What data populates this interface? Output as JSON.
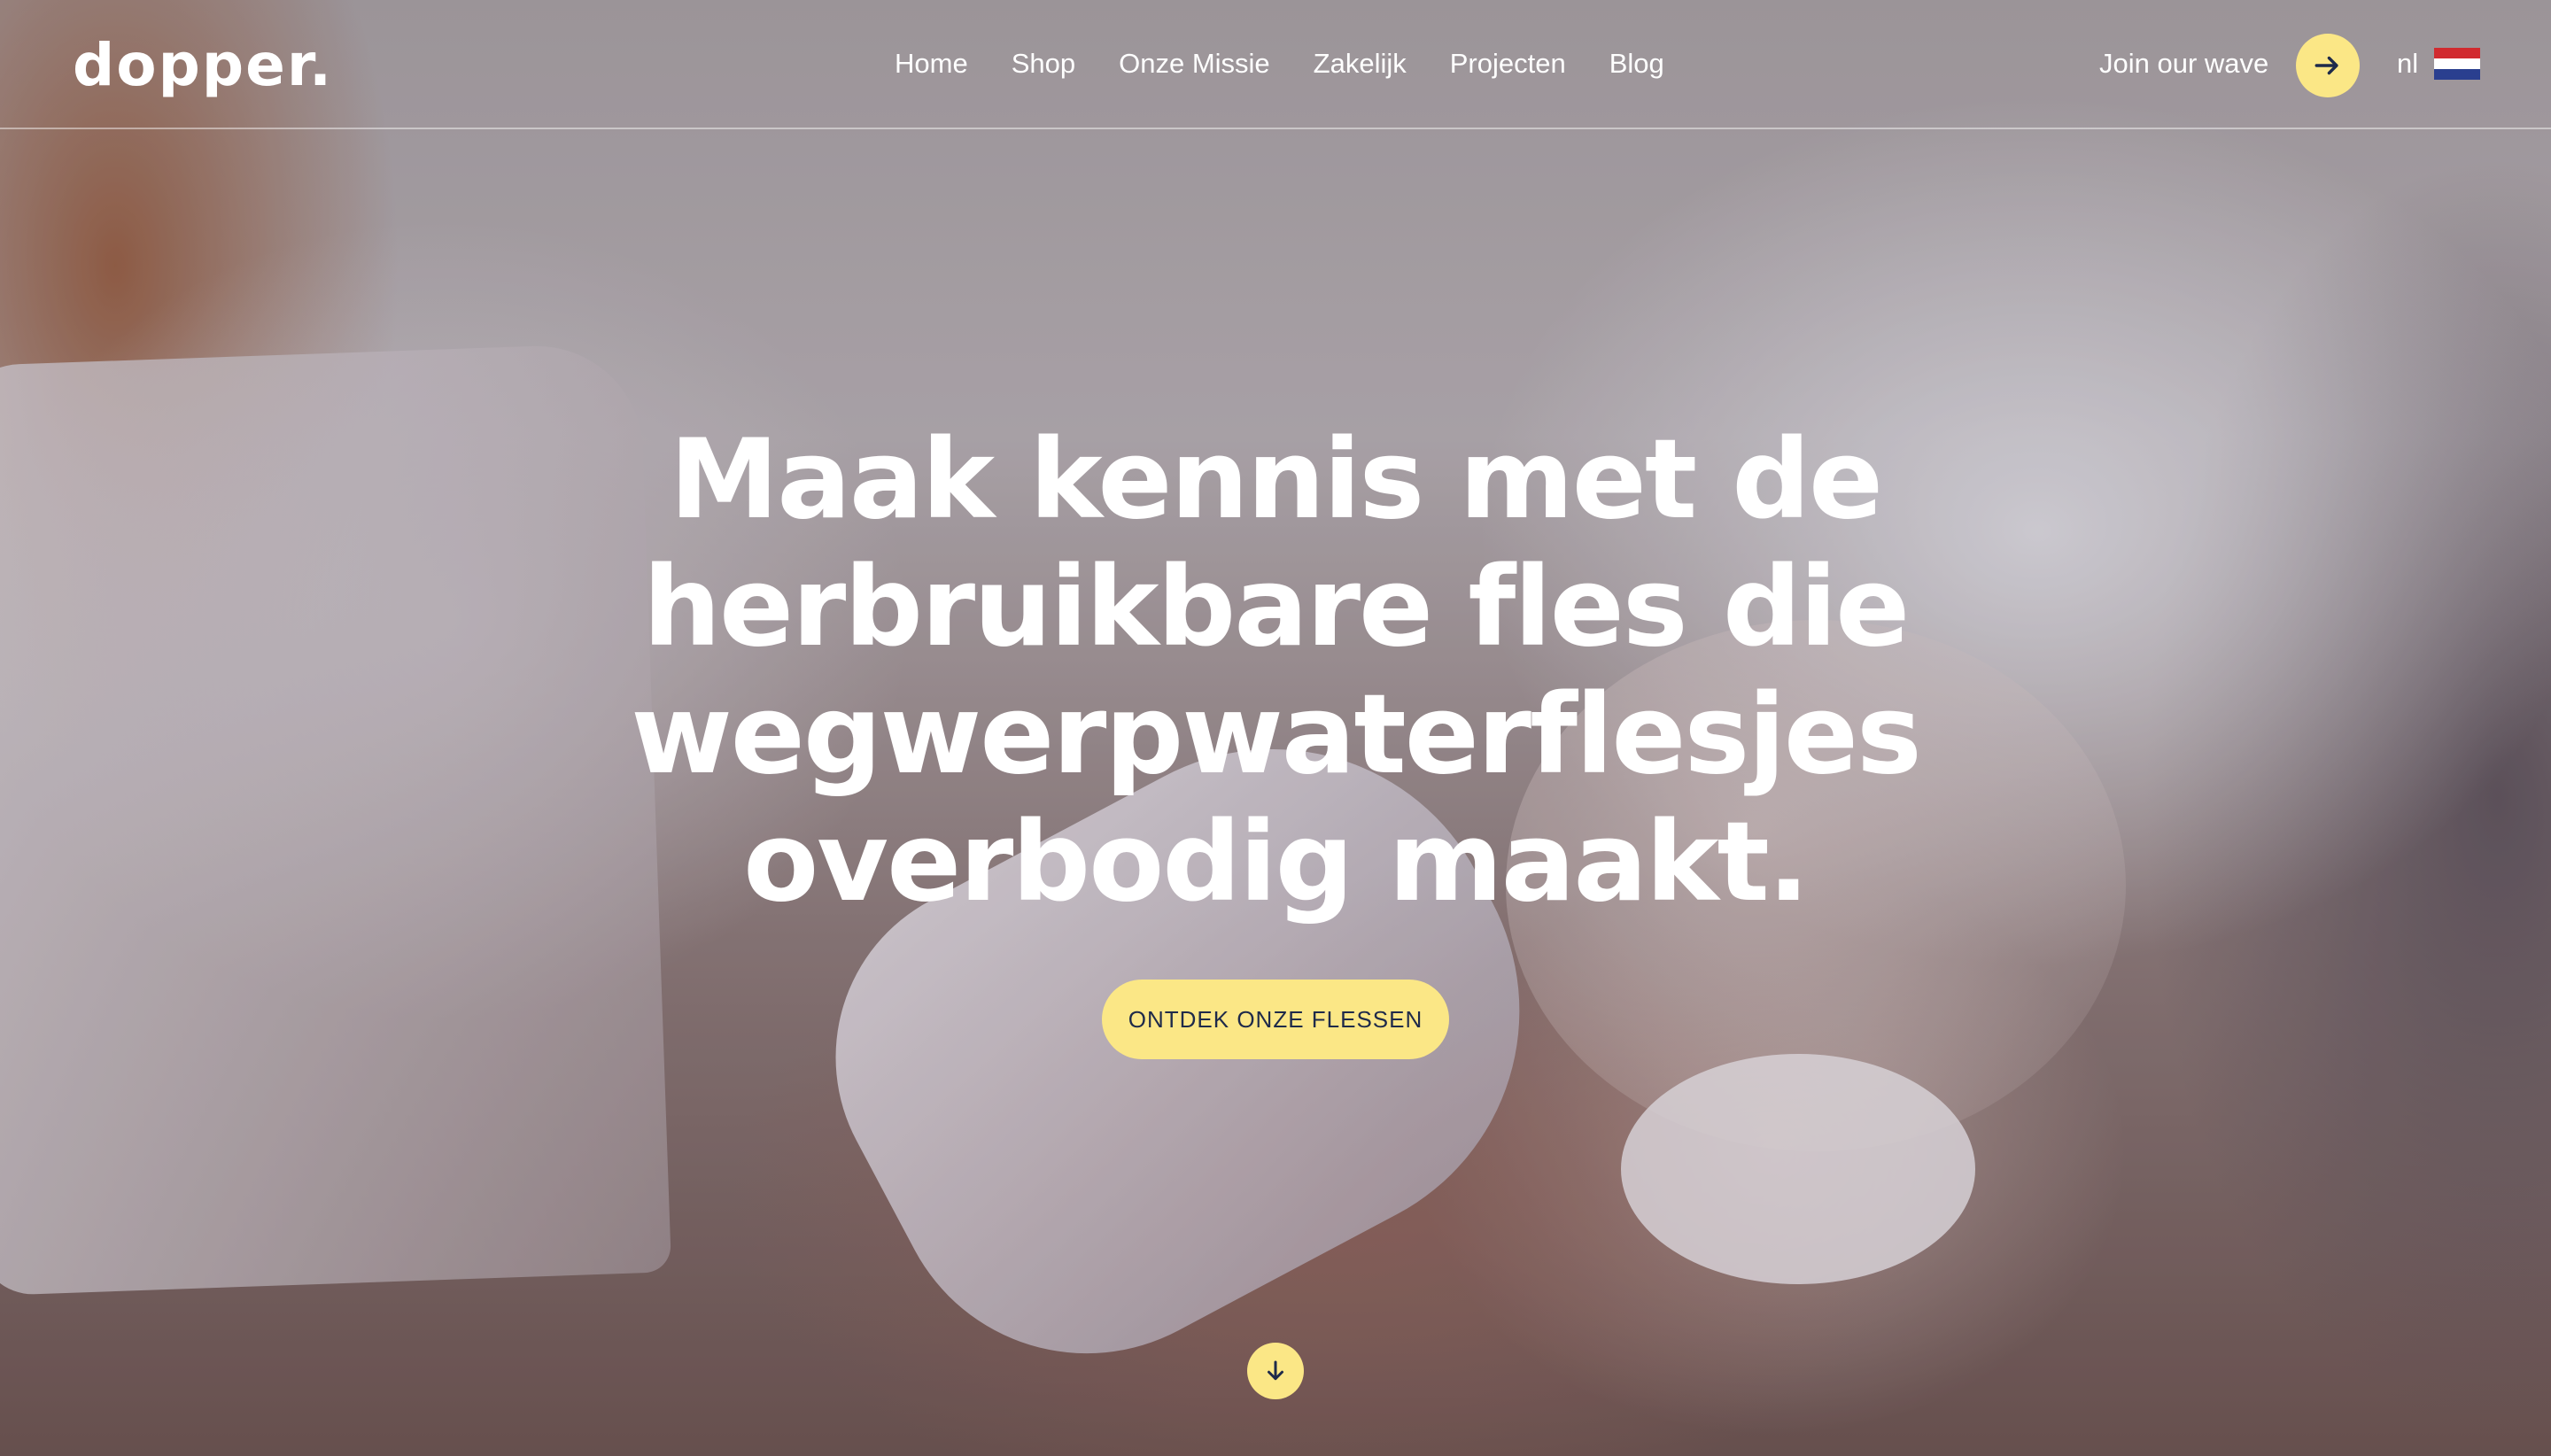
{
  "brand": {
    "logo_text": "dopper."
  },
  "nav": {
    "items": [
      "Home",
      "Shop",
      "Onze Missie",
      "Zakelijk",
      "Projecten",
      "Blog"
    ]
  },
  "header": {
    "join_label": "Join our wave",
    "language": "nl"
  },
  "hero": {
    "headline_lines": [
      "Maak kennis met de",
      "herbruikbare fles die",
      "wegwerpwaterflesjes",
      "overbodig maakt."
    ],
    "cta_label": "ONTDEK ONZE FLESSEN"
  },
  "colors": {
    "accent_yellow": "#fbe786",
    "dark_navy": "#1e2a4a"
  },
  "icons": {
    "join": "arrow-right-icon",
    "scroll": "arrow-down-icon",
    "flag": "netherlands-flag-icon"
  }
}
